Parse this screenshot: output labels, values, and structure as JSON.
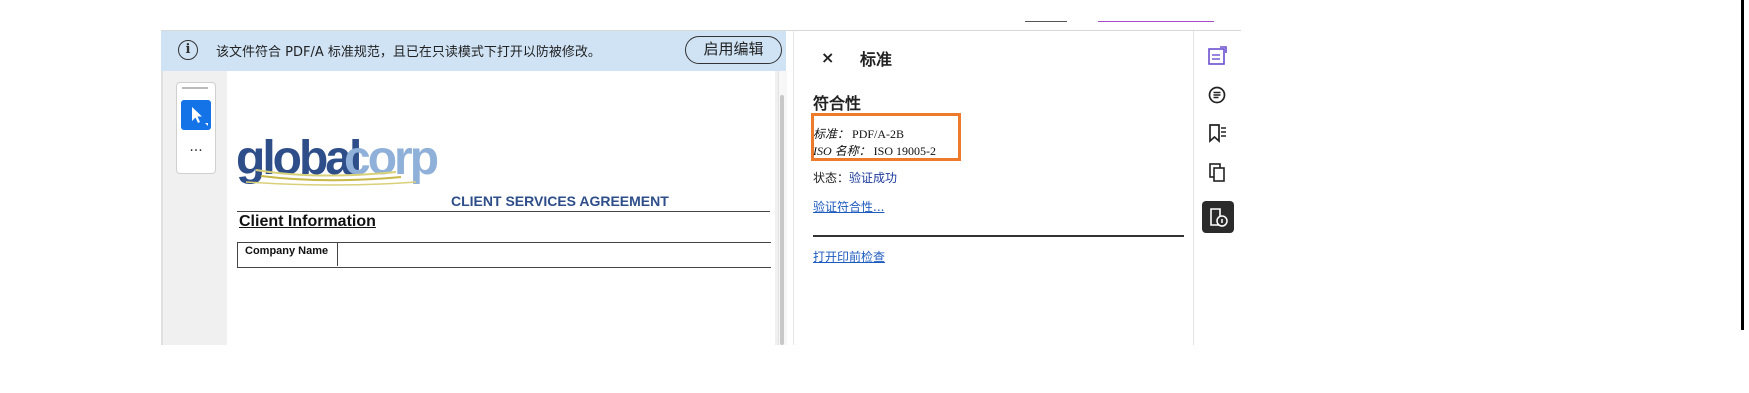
{
  "info_bar": {
    "message": "该文件符合 PDF/A 标准规范，且已在只读模式下打开以防被修改。",
    "enable_edit_label": "启用编辑"
  },
  "document": {
    "logo": {
      "text_part1": "global",
      "text_part2": "corp"
    },
    "agreement_title": "CLIENT SERVICES AGREEMENT",
    "section_title": "Client Information",
    "table_header": "Company Name"
  },
  "tools": {
    "more_label": "..."
  },
  "panel": {
    "close_glyph": "×",
    "title": "标准",
    "section_heading": "符合性",
    "standard_label": "标准：",
    "standard_value": "PDF/A-2B",
    "iso_label": "ISO 名称：",
    "iso_value": "ISO 19005-2",
    "status_label": "状态：",
    "status_value": "验证成功",
    "verify_link": "验证符合性...",
    "preflight_link": "打开印前检查"
  },
  "rail": {
    "icons": [
      "edit-pdf-icon",
      "comment-icon",
      "bookmark-icon",
      "pages-icon",
      "standards-icon"
    ]
  },
  "colors": {
    "info_bar_bg": "#cfe3f5",
    "accent_blue": "#1473e6",
    "highlight_orange": "#ee7b2c",
    "link_blue": "#1d5bbf",
    "logo_dark": "#2e4e8a",
    "logo_light": "#8fb0d8"
  }
}
